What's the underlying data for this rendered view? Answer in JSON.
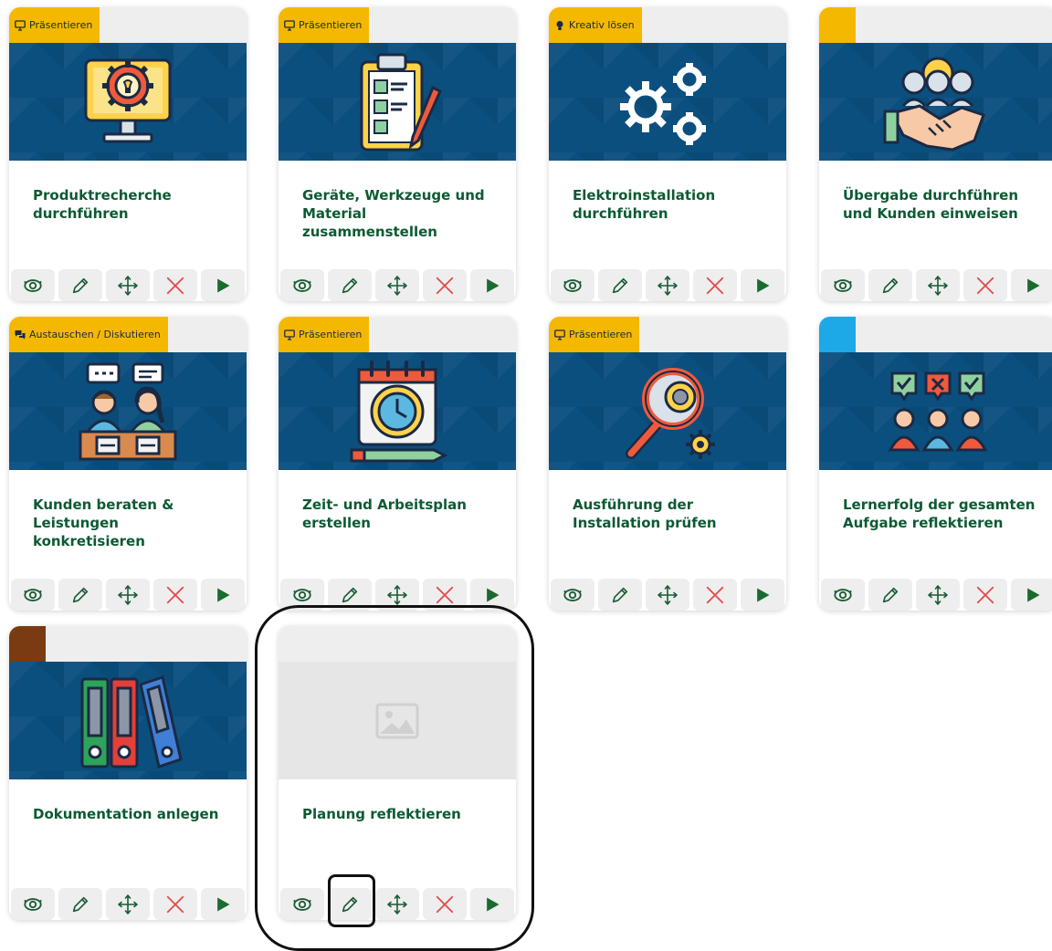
{
  "colors": {
    "banner": "#0b4f7e",
    "tag_yellow": "#f5b800",
    "tag_blue": "#1da9e8",
    "tag_brown": "#7a3b12",
    "title_green": "#0c5a33",
    "delete_red": "#e24b4b",
    "play_green": "#1a6b2e"
  },
  "cards": [
    {
      "tag": "Präsentieren",
      "tag_icon": "monitor-icon",
      "title": "Produktrecherche durchführen",
      "image": "gear-lightbulb-monitor-icon"
    },
    {
      "tag": "Präsentieren",
      "tag_icon": "monitor-icon",
      "title": "Geräte, Werkzeuge und Material zusammenstellen",
      "image": "clipboard-checklist-icon"
    },
    {
      "tag": "Kreativ lösen",
      "tag_icon": "lightbulb-icon",
      "title": "Elektroinstallation durchführen",
      "image": "gears-icon"
    },
    {
      "tag": "",
      "tag_icon": "",
      "title": "Übergabe durchführen und Kunden einweisen",
      "image": "handshake-team-icon"
    },
    {
      "tag": "Austauschen / Diskutieren",
      "tag_icon": "chat-icon",
      "title": "Kunden beraten & Leistungen konkretisieren",
      "image": "consultation-icon"
    },
    {
      "tag": "Präsentieren",
      "tag_icon": "monitor-icon",
      "title": "Zeit- und Arbeitsplan erstellen",
      "image": "calendar-clock-icon"
    },
    {
      "tag": "Präsentieren",
      "tag_icon": "monitor-icon",
      "title": "Ausführung der Installation prüfen",
      "image": "magnifier-gear-icon"
    },
    {
      "tag": "",
      "tag_icon": "",
      "title": "Lernerfolg der gesamten Aufgabe reflektieren",
      "image": "team-feedback-icon"
    },
    {
      "tag": "",
      "tag_icon": "",
      "title": "Dokumentation anlegen",
      "image": "binders-icon"
    },
    {
      "tag": "",
      "tag_icon": "",
      "title": "Planung reflektieren",
      "image": "image-placeholder-icon"
    }
  ],
  "actions": [
    "view-icon",
    "edit-icon",
    "move-icon",
    "delete-icon",
    "play-icon"
  ]
}
